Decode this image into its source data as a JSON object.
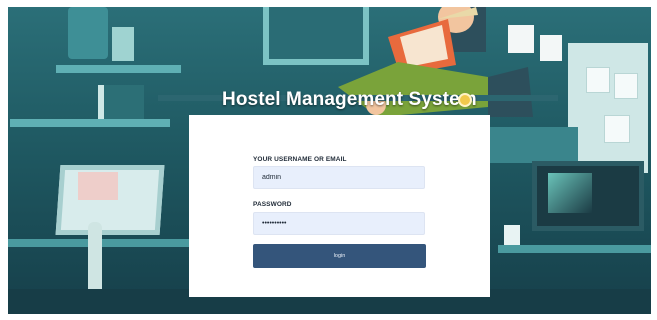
{
  "app": {
    "title": "Hostel Management System"
  },
  "login": {
    "username_label": "YOUR USERNAME OR EMAIL",
    "username_value": "admin",
    "password_label": "PASSWORD",
    "password_value": "••••••••••",
    "submit_label": "login"
  },
  "colors": {
    "background_teal": "#1f5962",
    "button": "#34557b",
    "field_fill": "#e8effc",
    "card": "#ffffff"
  }
}
